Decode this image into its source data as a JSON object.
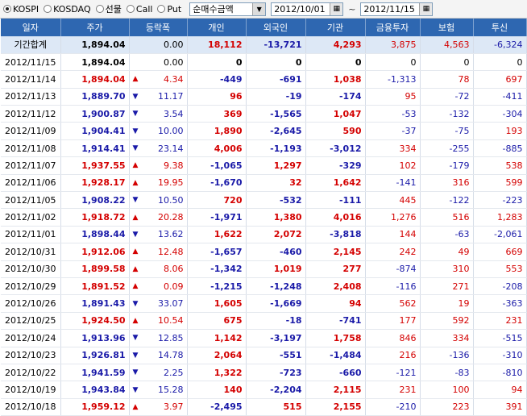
{
  "toolbar": {
    "radios": [
      {
        "label": "KOSPI",
        "selected": true
      },
      {
        "label": "KOSDAQ",
        "selected": false
      },
      {
        "label": "선물",
        "selected": false
      },
      {
        "label": "Call",
        "selected": false
      },
      {
        "label": "Put",
        "selected": false
      }
    ],
    "metric_select": "순매수금액",
    "start_date": "2012/10/01",
    "tilde": "~",
    "end_date": "2012/11/15"
  },
  "table": {
    "headers": [
      "일자",
      "주가",
      "등락폭",
      "개인",
      "외국인",
      "기관",
      "금융투자",
      "보험",
      "투신"
    ],
    "total": {
      "date": "기간합계",
      "price": "1,894.04",
      "change": "0.00",
      "dir": "",
      "indiv": "18,112",
      "foreign": "-13,721",
      "inst": "4,293",
      "fin": "3,875",
      "ins": "4,563",
      "trust": "-6,324"
    },
    "rows": [
      {
        "date": "2012/11/15",
        "price": "1,894.04",
        "change": "0.00",
        "dir": "",
        "indiv": "0",
        "foreign": "0",
        "inst": "0",
        "fin": "0",
        "ins": "0",
        "trust": "0"
      },
      {
        "date": "2012/11/14",
        "price": "1,894.04",
        "change": "4.34",
        "dir": "up",
        "indiv": "-449",
        "foreign": "-691",
        "inst": "1,038",
        "fin": "-1,313",
        "ins": "78",
        "trust": "697"
      },
      {
        "date": "2012/11/13",
        "price": "1,889.70",
        "change": "11.17",
        "dir": "down",
        "indiv": "96",
        "foreign": "-19",
        "inst": "-174",
        "fin": "95",
        "ins": "-72",
        "trust": "-411"
      },
      {
        "date": "2012/11/12",
        "price": "1,900.87",
        "change": "3.54",
        "dir": "down",
        "indiv": "369",
        "foreign": "-1,565",
        "inst": "1,047",
        "fin": "-53",
        "ins": "-132",
        "trust": "-304"
      },
      {
        "date": "2012/11/09",
        "price": "1,904.41",
        "change": "10.00",
        "dir": "down",
        "indiv": "1,890",
        "foreign": "-2,645",
        "inst": "590",
        "fin": "-37",
        "ins": "-75",
        "trust": "193"
      },
      {
        "date": "2012/11/08",
        "price": "1,914.41",
        "change": "23.14",
        "dir": "down",
        "indiv": "4,006",
        "foreign": "-1,193",
        "inst": "-3,012",
        "fin": "334",
        "ins": "-255",
        "trust": "-885"
      },
      {
        "date": "2012/11/07",
        "price": "1,937.55",
        "change": "9.38",
        "dir": "up",
        "indiv": "-1,065",
        "foreign": "1,297",
        "inst": "-329",
        "fin": "102",
        "ins": "-179",
        "trust": "538"
      },
      {
        "date": "2012/11/06",
        "price": "1,928.17",
        "change": "19.95",
        "dir": "up",
        "indiv": "-1,670",
        "foreign": "32",
        "inst": "1,642",
        "fin": "-141",
        "ins": "316",
        "trust": "599"
      },
      {
        "date": "2012/11/05",
        "price": "1,908.22",
        "change": "10.50",
        "dir": "down",
        "indiv": "720",
        "foreign": "-532",
        "inst": "-111",
        "fin": "445",
        "ins": "-122",
        "trust": "-223"
      },
      {
        "date": "2012/11/02",
        "price": "1,918.72",
        "change": "20.28",
        "dir": "up",
        "indiv": "-1,971",
        "foreign": "1,380",
        "inst": "4,016",
        "fin": "1,276",
        "ins": "516",
        "trust": "1,283"
      },
      {
        "date": "2012/11/01",
        "price": "1,898.44",
        "change": "13.62",
        "dir": "down",
        "indiv": "1,622",
        "foreign": "2,072",
        "inst": "-3,818",
        "fin": "144",
        "ins": "-63",
        "trust": "-2,061"
      },
      {
        "date": "2012/10/31",
        "price": "1,912.06",
        "change": "12.48",
        "dir": "up",
        "indiv": "-1,657",
        "foreign": "-460",
        "inst": "2,145",
        "fin": "242",
        "ins": "49",
        "trust": "669"
      },
      {
        "date": "2012/10/30",
        "price": "1,899.58",
        "change": "8.06",
        "dir": "up",
        "indiv": "-1,342",
        "foreign": "1,019",
        "inst": "277",
        "fin": "-874",
        "ins": "310",
        "trust": "553"
      },
      {
        "date": "2012/10/29",
        "price": "1,891.52",
        "change": "0.09",
        "dir": "up",
        "indiv": "-1,215",
        "foreign": "-1,248",
        "inst": "2,408",
        "fin": "-116",
        "ins": "271",
        "trust": "-208"
      },
      {
        "date": "2012/10/26",
        "price": "1,891.43",
        "change": "33.07",
        "dir": "down",
        "indiv": "1,605",
        "foreign": "-1,669",
        "inst": "94",
        "fin": "562",
        "ins": "19",
        "trust": "-363"
      },
      {
        "date": "2012/10/25",
        "price": "1,924.50",
        "change": "10.54",
        "dir": "up",
        "indiv": "675",
        "foreign": "-18",
        "inst": "-741",
        "fin": "177",
        "ins": "592",
        "trust": "231"
      },
      {
        "date": "2012/10/24",
        "price": "1,913.96",
        "change": "12.85",
        "dir": "down",
        "indiv": "1,142",
        "foreign": "-3,197",
        "inst": "1,758",
        "fin": "846",
        "ins": "334",
        "trust": "-515"
      },
      {
        "date": "2012/10/23",
        "price": "1,926.81",
        "change": "14.78",
        "dir": "down",
        "indiv": "2,064",
        "foreign": "-551",
        "inst": "-1,484",
        "fin": "216",
        "ins": "-136",
        "trust": "-310"
      },
      {
        "date": "2012/10/22",
        "price": "1,941.59",
        "change": "2.25",
        "dir": "down",
        "indiv": "1,322",
        "foreign": "-723",
        "inst": "-660",
        "fin": "-121",
        "ins": "-83",
        "trust": "-810"
      },
      {
        "date": "2012/10/19",
        "price": "1,943.84",
        "change": "15.28",
        "dir": "down",
        "indiv": "140",
        "foreign": "-2,204",
        "inst": "2,115",
        "fin": "231",
        "ins": "100",
        "trust": "94"
      },
      {
        "date": "2012/10/18",
        "price": "1,959.12",
        "change": "3.97",
        "dir": "up",
        "indiv": "-2,495",
        "foreign": "515",
        "inst": "2,155",
        "fin": "-210",
        "ins": "223",
        "trust": "391"
      }
    ]
  },
  "colors": {
    "header_bg": "#2e67b1",
    "positive": "#d40000",
    "negative": "#1a1aa8",
    "total_row_bg": "#dde8f6"
  },
  "icons": {
    "up": "triangle-up-icon",
    "down": "triangle-down-icon",
    "calendar": "calendar-icon",
    "dropdown": "chevron-down-icon"
  }
}
